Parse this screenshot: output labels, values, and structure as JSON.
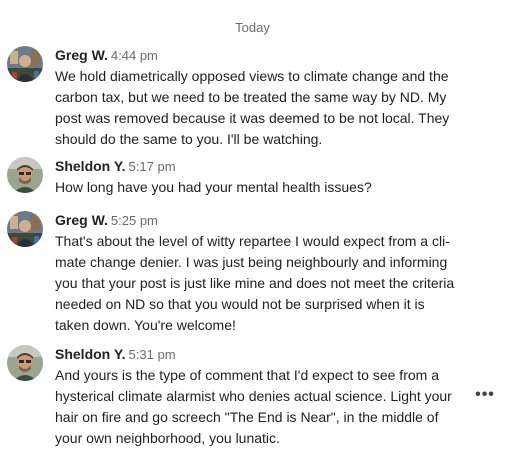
{
  "day_separator": "Today",
  "messages": [
    {
      "sender": "Greg W.",
      "time": "4:44 pm",
      "lines": [
        "We hold diametrically opposed views to climate change and the",
        "carbon tax, but we need to be treated the same way by ND. My",
        "post was removed because it was deemed to be not local. They",
        "should do the same to you. I'll be watching."
      ]
    },
    {
      "sender": "Sheldon Y.",
      "time": "5:17 pm",
      "lines": [
        "How long have you had your mental health issues?"
      ]
    },
    {
      "sender": "Greg W.",
      "time": "5:25 pm",
      "lines": [
        "That's about the level of witty repartee I would expect from a cli-",
        "mate change denier. I was just being neighbourly and informing",
        "you that your post is just like mine and does not meet the criteria",
        "needed on ND so that you would not be surprised when it is",
        "taken down. You're welcome!"
      ]
    },
    {
      "sender": "Sheldon Y.",
      "time": "5:31 pm",
      "lines": [
        "And yours is the type of comment that I'd expect to see from a",
        "hysterical climate alarmist who denies actual science. Light your",
        "hair on fire and go screech \"The End is Near\", in the middle of",
        "your own neighborhood, you lunatic."
      ]
    }
  ],
  "more_options_icon": "horizontal-ellipsis-icon",
  "more_options_glyph": "•••"
}
